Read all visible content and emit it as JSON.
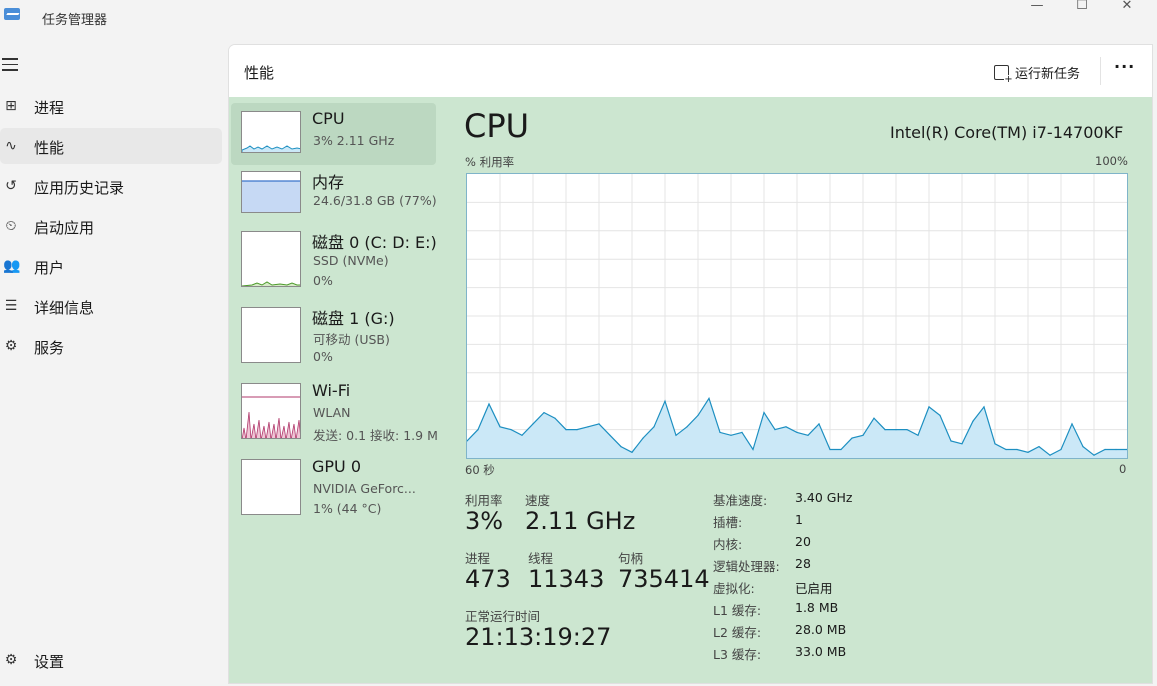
{
  "window": {
    "title": "任务管理器",
    "minimize": "—",
    "maximize": "☐",
    "close": "✕"
  },
  "sidebar": {
    "items": [
      {
        "label": "进程",
        "icon": "processes-icon",
        "glyph": "⊞",
        "active": true
      },
      {
        "label": "性能",
        "icon": "performance-icon",
        "glyph": "∿",
        "active": true
      },
      {
        "label": "应用历史记录",
        "icon": "history-icon",
        "glyph": "↺",
        "active": false
      },
      {
        "label": "启动应用",
        "icon": "startup-icon",
        "glyph": "⏲",
        "active": false
      },
      {
        "label": "用户",
        "icon": "users-icon",
        "glyph": "👥",
        "active": false
      },
      {
        "label": "详细信息",
        "icon": "details-icon",
        "glyph": "☰",
        "active": false
      },
      {
        "label": "服务",
        "icon": "services-icon",
        "glyph": "⚙",
        "active": false
      }
    ],
    "settings": {
      "label": "设置",
      "icon": "settings-icon",
      "glyph": "⚙"
    }
  },
  "header": {
    "title": "性能",
    "run_task": "运行新任务",
    "more": "···"
  },
  "devices": [
    {
      "name": "CPU",
      "sub1": "3% 2.11 GHz",
      "sub2": "",
      "selected": true
    },
    {
      "name": "内存",
      "sub1": "24.6/31.8 GB (77%)",
      "sub2": "",
      "selected": false
    },
    {
      "name": "磁盘 0 (C: D: E:)",
      "sub1": "SSD (NVMe)",
      "sub2": "0%",
      "selected": false
    },
    {
      "name": "磁盘 1 (G:)",
      "sub1": "可移动 (USB)",
      "sub2": "0%",
      "selected": false
    },
    {
      "name": "Wi-Fi",
      "sub1": "WLAN",
      "sub2": "发送: 0.1  接收: 1.9 M",
      "selected": false
    },
    {
      "name": "GPU 0",
      "sub1": "NVIDIA GeForc...",
      "sub2": "1% (44 °C)",
      "selected": false
    }
  ],
  "cpu": {
    "title": "CPU",
    "model": "Intel(R) Core(TM) i7-14700KF",
    "axis_top_left": "% 利用率",
    "axis_top_right": "100%",
    "axis_bottom_left": "60 秒",
    "axis_bottom_right": "0",
    "stats": {
      "util_label": "利用率",
      "util_value": "3%",
      "speed_label": "速度",
      "speed_value": "2.11 GHz",
      "proc_label": "进程",
      "proc_value": "473",
      "thread_label": "线程",
      "thread_value": "11343",
      "handle_label": "句柄",
      "handle_value": "735414",
      "uptime_label": "正常运行时间",
      "uptime_value": "21:13:19:27"
    },
    "specs": [
      {
        "label": "基准速度:",
        "value": "3.40 GHz"
      },
      {
        "label": "插槽:",
        "value": "1"
      },
      {
        "label": "内核:",
        "value": "20"
      },
      {
        "label": "逻辑处理器:",
        "value": "28"
      },
      {
        "label": "虚拟化:",
        "value": "已启用"
      },
      {
        "label": "L1 缓存:",
        "value": "1.8 MB"
      },
      {
        "label": "L2 缓存:",
        "value": "28.0 MB"
      },
      {
        "label": "L3 缓存:",
        "value": "33.0 MB"
      }
    ]
  },
  "chart_data": {
    "type": "area",
    "title": "",
    "xlabel": "60 秒",
    "ylabel": "% 利用率",
    "xlim": [
      60,
      0
    ],
    "ylim": [
      0,
      100
    ],
    "grid": true,
    "x": [
      60,
      59,
      58,
      57,
      56,
      55,
      54,
      53,
      52,
      51,
      50,
      49,
      48,
      47,
      46,
      45,
      44,
      43,
      42,
      41,
      40,
      39,
      38,
      37,
      36,
      35,
      34,
      33,
      32,
      31,
      30,
      29,
      28,
      27,
      26,
      25,
      24,
      23,
      22,
      21,
      20,
      19,
      18,
      17,
      16,
      15,
      14,
      13,
      12,
      11,
      10,
      9,
      8,
      7,
      6,
      5,
      4,
      3,
      2,
      1,
      0
    ],
    "series": [
      {
        "values": [
          6,
          10,
          19,
          11,
          10,
          8,
          12,
          16,
          14,
          10,
          10,
          11,
          12,
          8,
          4,
          2,
          7,
          11,
          20,
          8,
          11,
          15,
          21,
          9,
          8,
          9,
          3,
          16,
          10,
          11,
          9,
          8,
          12,
          3,
          3,
          7,
          8,
          14,
          10,
          10,
          10,
          8,
          18,
          15,
          6,
          5,
          13,
          18,
          5,
          3,
          3,
          2,
          4,
          1,
          3,
          12,
          4,
          1,
          3,
          3,
          3
        ]
      }
    ],
    "colors": {
      "line": "#1d8fc1",
      "fill": "#cbe8f7",
      "grid": "#e4e4e4"
    }
  }
}
